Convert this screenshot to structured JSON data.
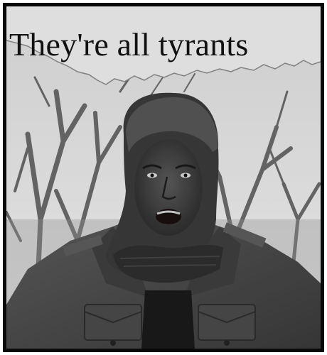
{
  "poster": {
    "headline": "They're all tyrants"
  },
  "image": {
    "subject": "man-in-hood-and-jacket",
    "background": "bare-trees"
  },
  "colors": {
    "frame": "#0a0a0a",
    "paper": "#ececec",
    "sky": "#e9e9e9",
    "jacket": "#4c4c4c",
    "skin": "#3a3a3a"
  }
}
